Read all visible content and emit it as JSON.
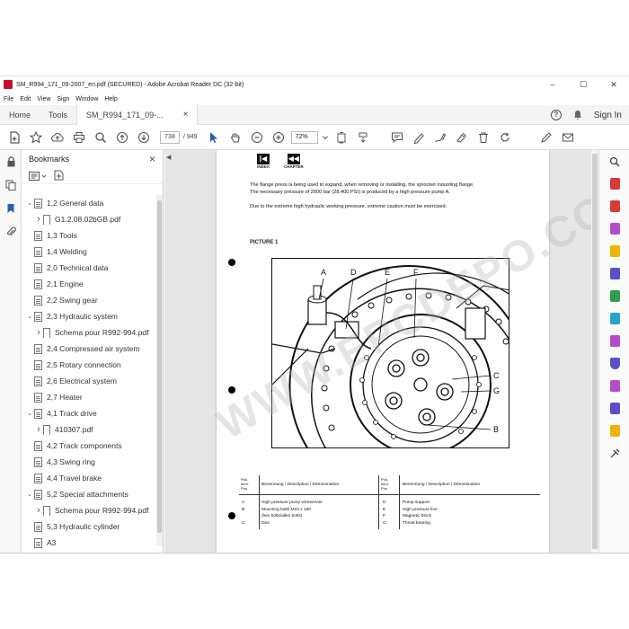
{
  "window": {
    "title": "SM_R994_171_09-2007_en.pdf (SECURED) - Adobe Acrobat Reader DC (32-bit)",
    "controls": [
      "–",
      "☐",
      "✕"
    ]
  },
  "menu": [
    "File",
    "Edit",
    "View",
    "Sign",
    "Window",
    "Help"
  ],
  "tabs": {
    "home": "Home",
    "tools": "Tools",
    "doc": "SM_R994_171_09-...",
    "doc_close": "×",
    "signin": "Sign In"
  },
  "toolbar": {
    "page_current": "738",
    "page_total": "/ 949",
    "zoom": "72%"
  },
  "bookmarks": {
    "title": "Bookmarks",
    "close": "×",
    "items": [
      {
        "label": "1,2 General data",
        "chev": "v",
        "icon": "page",
        "indent": 0
      },
      {
        "label": "G1.2.08.02bGB.pdf",
        "chev": ">",
        "icon": "bookmark",
        "indent": 1
      },
      {
        "label": "1,3 Tools",
        "chev": "",
        "icon": "page",
        "indent": 0
      },
      {
        "label": "1,4 Welding",
        "chev": "",
        "icon": "page",
        "indent": 0
      },
      {
        "label": "2,0 Technical data",
        "chev": "",
        "icon": "page",
        "indent": 0
      },
      {
        "label": "2,1 Engine",
        "chev": "",
        "icon": "page",
        "indent": 0
      },
      {
        "label": "2,2 Swing gear",
        "chev": "",
        "icon": "page",
        "indent": 0
      },
      {
        "label": "2,3 Hydraulic system",
        "chev": "v",
        "icon": "page",
        "indent": 0
      },
      {
        "label": "Schema pour R992-994.pdf",
        "chev": ">",
        "icon": "bookmark",
        "indent": 1
      },
      {
        "label": "2,4 Compressed air system",
        "chev": "",
        "icon": "page",
        "indent": 0
      },
      {
        "label": "2,5 Rotary connection",
        "chev": "",
        "icon": "page",
        "indent": 0
      },
      {
        "label": "2,6 Electrical system",
        "chev": "",
        "icon": "page",
        "indent": 0
      },
      {
        "label": "2,7 Heater",
        "chev": "",
        "icon": "page",
        "indent": 0
      },
      {
        "label": "4,1 Track drive",
        "chev": "v",
        "icon": "page",
        "indent": 0
      },
      {
        "label": "410307.pdf",
        "chev": ">",
        "icon": "bookmark",
        "indent": 1
      },
      {
        "label": "4,2 Track components",
        "chev": "",
        "icon": "page",
        "indent": 0
      },
      {
        "label": "4,3 Swing ring",
        "chev": "",
        "icon": "page",
        "indent": 0
      },
      {
        "label": "4,4 Travel brake",
        "chev": "",
        "icon": "page",
        "indent": 0
      },
      {
        "label": "5,2 Special attachments",
        "chev": "v",
        "icon": "page",
        "indent": 0
      },
      {
        "label": "Schema pour R992-994.pdf",
        "chev": ">",
        "icon": "bookmark",
        "indent": 1
      },
      {
        "label": "5,3 Hydraulic cylinder",
        "chev": "",
        "icon": "page",
        "indent": 0
      },
      {
        "label": "A3",
        "chev": "",
        "icon": "page",
        "indent": 0
      }
    ]
  },
  "document": {
    "nav_index": "INDEX",
    "nav_chapter": "CHAPTER",
    "para1": "The flange press is being used to expand, when removing or installing, the sprocket mounting flange.",
    "para2": "The necessary pressure of 2000 bar (28,400 PSI) is produced by a high pressure pump A.",
    "para3": "Due to the extreme high hydraulic working pressure, extreme caution must be exercised.",
    "picture_title": "PICTURE 1",
    "callouts": {
      "a": "A",
      "b": "B",
      "c": "C",
      "d": "D",
      "e": "E",
      "f": "F",
      "g": "G"
    },
    "table": {
      "pos_header": "Pos.\nItem.\nPos.",
      "desc_header": "Benennung / Description / Dénomination",
      "left": [
        {
          "pos": "A",
          "desc": "High pressure pump w/reservoir"
        },
        {
          "pos": "B",
          "desc": "Mounting bolts M24 x 150"
        },
        {
          "pos": "",
          "desc": "(hex bolts/allen bolts)"
        },
        {
          "pos": "C",
          "desc": "Disc"
        }
      ],
      "right": [
        {
          "pos": "D",
          "desc": "Pump support"
        },
        {
          "pos": "E",
          "desc": "High pressure line"
        },
        {
          "pos": "F",
          "desc": "Magnetic block"
        },
        {
          "pos": "G",
          "desc": "Thrust bearing"
        }
      ]
    }
  },
  "watermark": "WWW.EPCDEPO.COM"
}
